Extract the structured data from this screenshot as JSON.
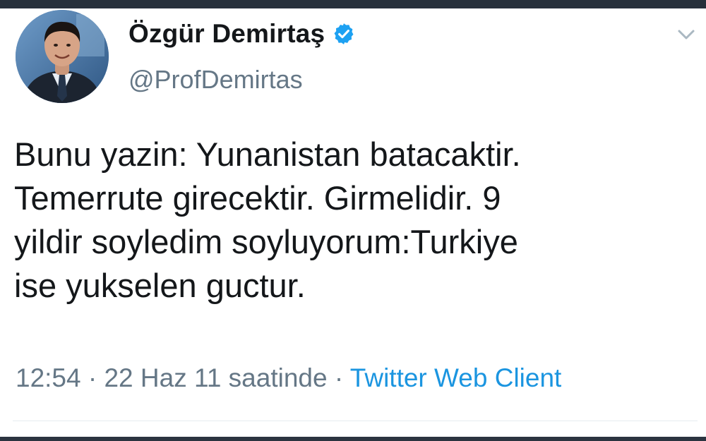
{
  "tweet": {
    "author": {
      "display_name": "Özgür Demirtaş",
      "handle": "@ProfDemirtas",
      "verified": true,
      "avatar_icon": "profile-photo"
    },
    "text_lines": [
      "Bunu yazin: Yunanistan batacaktir.",
      "Temerrute girecektir. Girmelidir. 9",
      "yildir soyledim soyluyorum:Turkiye",
      "ise yukselen guctur."
    ],
    "meta": {
      "time": "12:54",
      "separator": " · ",
      "date": "22 Haz 11 saatinde",
      "source": "Twitter Web Client"
    },
    "menu_icon": "chevron-down-icon"
  },
  "colors": {
    "text_primary": "#14171a",
    "text_secondary": "#657786",
    "link": "#1b95e0",
    "verified": "#1da1f2",
    "top_bar": "#27303b"
  }
}
